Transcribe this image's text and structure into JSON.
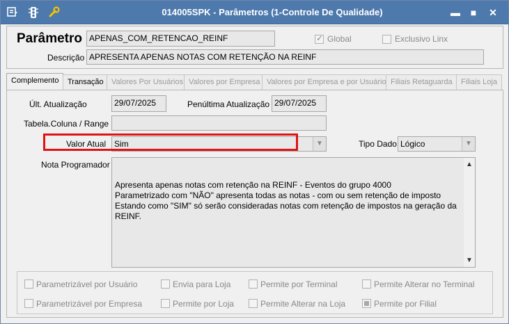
{
  "window": {
    "title": "014005SPK - Parâmetros (1-Controle De Qualidade)"
  },
  "titlebar_icons": [
    "menu-icon",
    "traffic-light-icon",
    "wrench-icon"
  ],
  "window_buttons": {
    "minimize": "▬",
    "maximize": "■",
    "close": "✕"
  },
  "header": {
    "parametro_label": "Parâmetro",
    "parametro_value": "APENAS_COM_RETENCAO_REINF",
    "global_label": "Global",
    "exclusivo_label": "Exclusivo Linx",
    "descricao_label": "Descrição",
    "descricao_value": "APRESENTA APENAS NOTAS COM RETENÇÃO NA REINF"
  },
  "tabs": [
    {
      "label": "Complemento",
      "state": "active"
    },
    {
      "label": "Transação",
      "state": "enabled"
    },
    {
      "label": "Valores Por Usuários",
      "state": "disabled"
    },
    {
      "label": "Valores por Empresa",
      "state": "disabled"
    },
    {
      "label": "Valores por Empresa e por Usuário",
      "state": "disabled"
    },
    {
      "label": "Filiais Retaguarda",
      "state": "disabled"
    },
    {
      "label": "Filiais Loja",
      "state": "disabled"
    }
  ],
  "form": {
    "ult_atualizacao_label": "Últ. Atualização",
    "ult_atualizacao_value": "29/07/2025",
    "penultima_label": "Penúltima Atualização",
    "penultima_value": "29/07/2025",
    "tabela_label": "Tabela.Coluna / Range",
    "tabela_value": "",
    "valor_atual_label": "Valor Atual",
    "valor_atual_value": "Sim",
    "tipo_dado_label": "Tipo Dado",
    "tipo_dado_value": "Lógico",
    "nota_label": "Nota Programador",
    "nota_value": "Apresenta apenas notas com retenção na REINF - Eventos do grupo 4000\nParametrizado com \"NÃO\" apresenta todas as notas - com ou sem retenção de imposto\nEstando como \"SIM\" só serão consideradas notas com retenção de impostos na geração da\nREINF."
  },
  "options": {
    "row1": [
      "Parametrizável por Usuário",
      "Envia para Loja",
      "Permite por Terminal",
      "Permite Alterar no Terminal"
    ],
    "row2": [
      "Parametrizável por Empresa",
      "Permite por Loja",
      "Permite Alterar na Loja",
      "Permite por Filial"
    ],
    "checked": [
      "Permite por Filial"
    ]
  },
  "colors": {
    "titlebar": "#4d79ad",
    "highlight": "#e01313"
  }
}
